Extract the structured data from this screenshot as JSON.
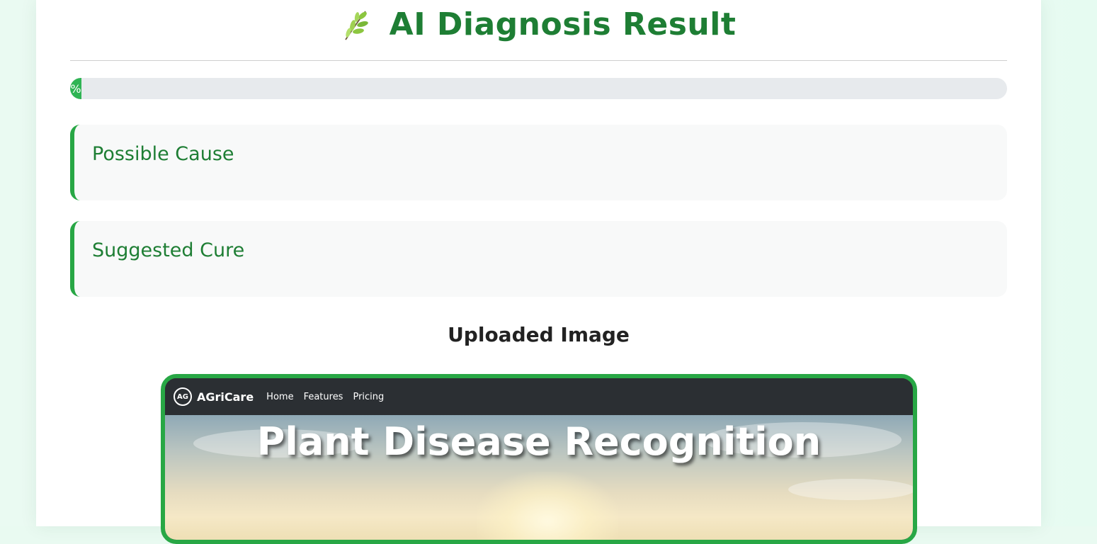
{
  "header": {
    "title": "AI Diagnosis Result",
    "icon": "leaf-icon"
  },
  "progress": {
    "percent": 1,
    "label": "%"
  },
  "results": {
    "cause_heading": "Possible Cause",
    "cure_heading": "Suggested Cure"
  },
  "uploaded": {
    "heading": "Uploaded Image",
    "screenshot": {
      "logo_text": "AG",
      "brand": "AGriCare",
      "nav_links": [
        "Home",
        "Features",
        "Pricing"
      ],
      "hero_title": "Plant Disease Recognition"
    }
  },
  "colors": {
    "accent": "#28a745",
    "title": "#1e7e34",
    "track": "#e7eaed"
  }
}
